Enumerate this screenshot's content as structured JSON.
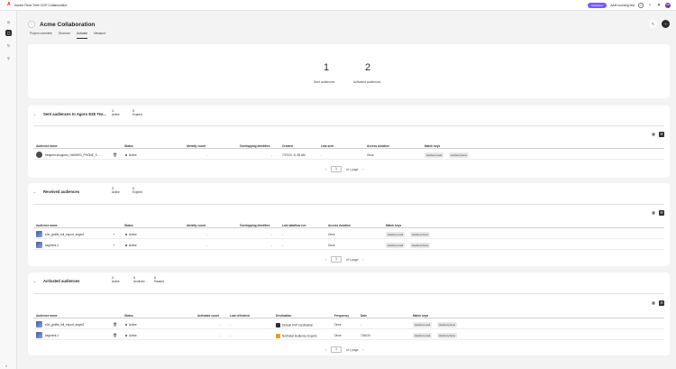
{
  "app": {
    "title": "Adobe Real-Time CDP Collaboration",
    "advertiser_badge": "Advertiser",
    "account_name": "AAM sourcing test",
    "avatar_initials": "AB"
  },
  "page": {
    "title": "Acme Collaboration"
  },
  "tabs": [
    "Project overview",
    "Discover",
    "Activate",
    "Measure"
  ],
  "summary": {
    "sent_count": "1",
    "sent_label": "Sent audiences",
    "activated_count": "2",
    "activated_label": "Activated audiences"
  },
  "sent_section": {
    "title": "Sent audiences to Agoro E2E Tes...",
    "stats": [
      {
        "n": "1",
        "label": "Active"
      },
      {
        "n": "0",
        "label": "Expired"
      }
    ],
    "headers": [
      "Audience name",
      "Status",
      "Identity count",
      "Overlapping identities",
      "Created",
      "Last sent",
      "Access duration",
      "Match keys"
    ],
    "rows": [
      {
        "name": "frequent shoppers_HASHED_PHONE_S...",
        "status": "Active",
        "identity": "-",
        "overlap": "-",
        "created": "7/27/24, 11:35 AM",
        "last_sent": "-",
        "duration": "Once",
        "keys": [
          "Hashed email",
          "Hashed phone"
        ]
      }
    ],
    "pager": {
      "page": "1",
      "of": "of 1 page"
    }
  },
  "received_section": {
    "title": "Received audiences",
    "stats": [
      {
        "n": "2",
        "label": "Active"
      },
      {
        "n": "0",
        "label": "Expired"
      }
    ],
    "headers": [
      "Audience name",
      "Status",
      "Identity count",
      "Overlapping identities",
      "Last dataflow run",
      "Access duration",
      "Match keys"
    ],
    "rows": [
      {
        "name": "e2e_jpnfile_full_export_segm2",
        "status": "Active",
        "identity": "-",
        "overlap": "-",
        "last_run": "-",
        "duration": "Once",
        "keys": [
          "Hashed email",
          "Hashed phone"
        ]
      },
      {
        "name": "segment-1",
        "status": "Active",
        "identity": "-",
        "overlap": "-",
        "last_run": "-",
        "duration": "Once",
        "keys": [
          "Hashed email",
          "Hashed phone"
        ]
      }
    ],
    "pager": {
      "page": "1",
      "of": "of 1 page"
    }
  },
  "activated_section": {
    "title": "Activated audiences",
    "stats": [
      {
        "n": "2",
        "label": "Active"
      },
      {
        "n": "0",
        "label": "Archived"
      },
      {
        "n": "0",
        "label": "Paused"
      }
    ],
    "headers": [
      "Audience name",
      "Status",
      "Activated count",
      "Last refreshed",
      "Destination",
      "Frequency",
      "Date",
      "Match keys"
    ],
    "rows": [
      {
        "name": "e2e_jpnfile_full_export_segm2",
        "status": "Active",
        "count": "-",
        "refreshed": "-",
        "destination": "Default HVP Destination",
        "dest_color": "#2c2c2c",
        "frequency": "Once",
        "date": "-",
        "keys": [
          "Hashed email",
          "Hashed phone"
        ]
      },
      {
        "name": "segment-1",
        "status": "Active",
        "count": "-",
        "refreshed": "-",
        "destination": "Northstar Audience Exports",
        "dest_color": "#f29a1f",
        "frequency": "Once",
        "date": "7/26/24",
        "keys": [
          "Hashed email",
          "Hashed phone"
        ]
      }
    ],
    "pager": {
      "page": "1",
      "of": "of 1 page"
    }
  }
}
